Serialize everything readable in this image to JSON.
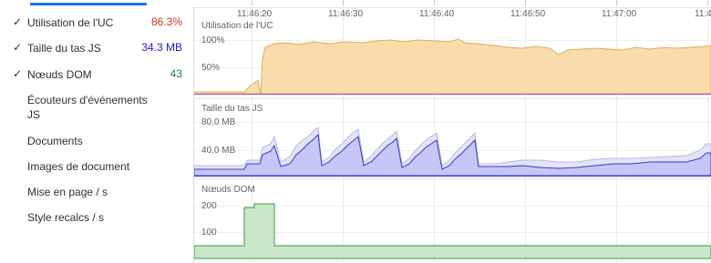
{
  "sidebar": {
    "metrics": [
      {
        "label": "Utilisation de l'UC",
        "value": "86.3%",
        "checked": true,
        "color": "#d93025"
      },
      {
        "label": "Taille du tas JS",
        "value": "34.3 MB",
        "checked": true,
        "color": "#1a1ad9"
      },
      {
        "label": "Nœuds DOM",
        "value": "43",
        "checked": true,
        "color": "#188038"
      },
      {
        "label": "Écouteurs d'événements JS",
        "value": "",
        "checked": false
      },
      {
        "label": "Documents",
        "value": "",
        "checked": false
      },
      {
        "label": "Images de document",
        "value": "",
        "checked": false
      },
      {
        "label": "Mise en page / s",
        "value": "",
        "checked": false
      },
      {
        "label": "Style recalcs / s",
        "value": "",
        "checked": false
      }
    ]
  },
  "timeline": {
    "timestamps": [
      "11:46:20",
      "11:46:30",
      "11:46:40",
      "11:46:50",
      "11:47:00",
      "11:4"
    ],
    "panes": [
      {
        "title": "Utilisation de l'UC",
        "ticks": [
          "100%",
          "50%"
        ],
        "fill": "#f9dcab",
        "stroke": "#e8a95b"
      },
      {
        "title": "Taille du tas JS",
        "ticks": [
          "80.0 MB",
          "40.0 MB"
        ],
        "fill": "#c6c6f7",
        "stroke": "#3a3ad0"
      },
      {
        "title": "Nœuds DOM",
        "ticks": [
          "200",
          "100"
        ],
        "fill": "#c9e7c9",
        "stroke": "#3c9a3c"
      }
    ]
  },
  "colors": {
    "accent": "#1a73e8"
  }
}
